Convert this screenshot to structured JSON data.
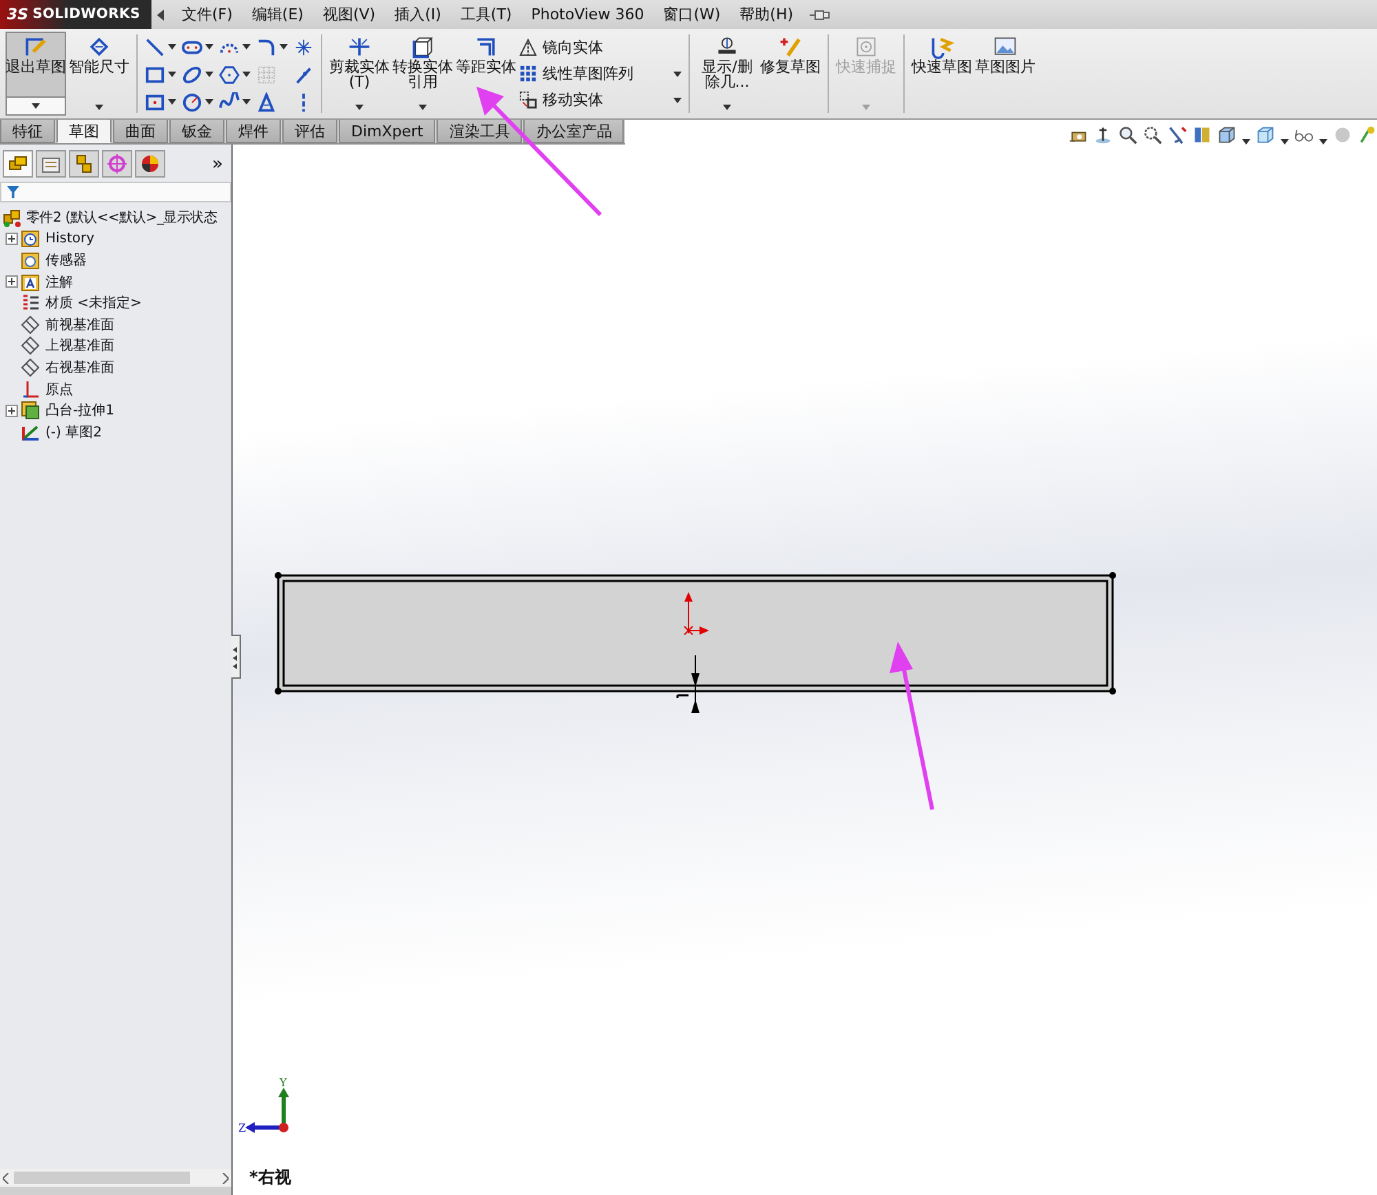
{
  "app": {
    "logo": "SOLIDWORKS",
    "logo_prefix": "3S"
  },
  "menu": [
    {
      "label": "文件(F)"
    },
    {
      "label": "编辑(E)"
    },
    {
      "label": "视图(V)"
    },
    {
      "label": "插入(I)"
    },
    {
      "label": "工具(T)"
    },
    {
      "label": "PhotoView 360"
    },
    {
      "label": "窗口(W)"
    },
    {
      "label": "帮助(H)"
    }
  ],
  "ribbon": {
    "sketch_buttons": [
      {
        "label": "退出草图",
        "kind": "exit",
        "selected": true
      },
      {
        "label": "智能尺寸",
        "kind": "dimension",
        "selected": false
      }
    ],
    "edit_buttons": [
      {
        "label": "剪裁实体(T)",
        "kind": "trim"
      },
      {
        "label": "转换实体引用",
        "kind": "convert"
      },
      {
        "label": "等距实体",
        "kind": "offset"
      }
    ],
    "edit_small": [
      {
        "label": "镜向实体",
        "kind": "mirror"
      },
      {
        "label": "线性草图阵列",
        "kind": "pattern"
      },
      {
        "label": "移动实体",
        "kind": "move"
      }
    ],
    "relation_buttons": [
      {
        "label": "显示/删除几...",
        "kind": "relations",
        "disabled": false
      },
      {
        "label": "修复草图",
        "kind": "repair",
        "disabled": false
      }
    ],
    "snap_buttons": [
      {
        "label": "快速捕捉",
        "kind": "snap",
        "disabled": true
      }
    ],
    "extra_buttons": [
      {
        "label": "快速草图",
        "kind": "quick",
        "disabled": false
      },
      {
        "label": "草图图片",
        "kind": "picture",
        "disabled": false
      }
    ]
  },
  "tabs": [
    {
      "label": "特征",
      "selected": false
    },
    {
      "label": "草图",
      "selected": true
    },
    {
      "label": "曲面",
      "selected": false
    },
    {
      "label": "钣金",
      "selected": false
    },
    {
      "label": "焊件",
      "selected": false
    },
    {
      "label": "评估",
      "selected": false
    },
    {
      "label": "DimXpert",
      "selected": false
    },
    {
      "label": "渲染工具",
      "selected": false
    },
    {
      "label": "办公室产品",
      "selected": false
    }
  ],
  "tree": {
    "label": "零件2 (默认<<默认>_显示状态",
    "kind": "part",
    "expandable": false,
    "children": [
      {
        "label": "History",
        "kind": "history",
        "expandable": true
      },
      {
        "label": "传感器",
        "kind": "sensor",
        "expandable": false
      },
      {
        "label": "注解",
        "kind": "annotation",
        "expandable": true
      },
      {
        "label": "材质 <未指定>",
        "kind": "material",
        "expandable": false
      },
      {
        "label": "前视基准面",
        "kind": "plane",
        "expandable": false
      },
      {
        "label": "上视基准面",
        "kind": "plane",
        "expandable": false
      },
      {
        "label": "右视基准面",
        "kind": "plane",
        "expandable": false
      },
      {
        "label": "原点",
        "kind": "origin",
        "expandable": false
      },
      {
        "label": "凸台-拉伸1",
        "kind": "feature",
        "expandable": true
      },
      {
        "label": "(-) 草图2",
        "kind": "sketch",
        "expandable": false
      }
    ]
  },
  "panel_tabs": [
    {
      "kind": "feature",
      "selected": true
    },
    {
      "kind": "property",
      "selected": false
    },
    {
      "kind": "config",
      "selected": false
    },
    {
      "kind": "dimxpert",
      "selected": false
    },
    {
      "kind": "display",
      "selected": false
    }
  ],
  "panel_more": "»",
  "view": {
    "name": "*右视",
    "axis_y": "Y",
    "axis_z": "Z"
  }
}
